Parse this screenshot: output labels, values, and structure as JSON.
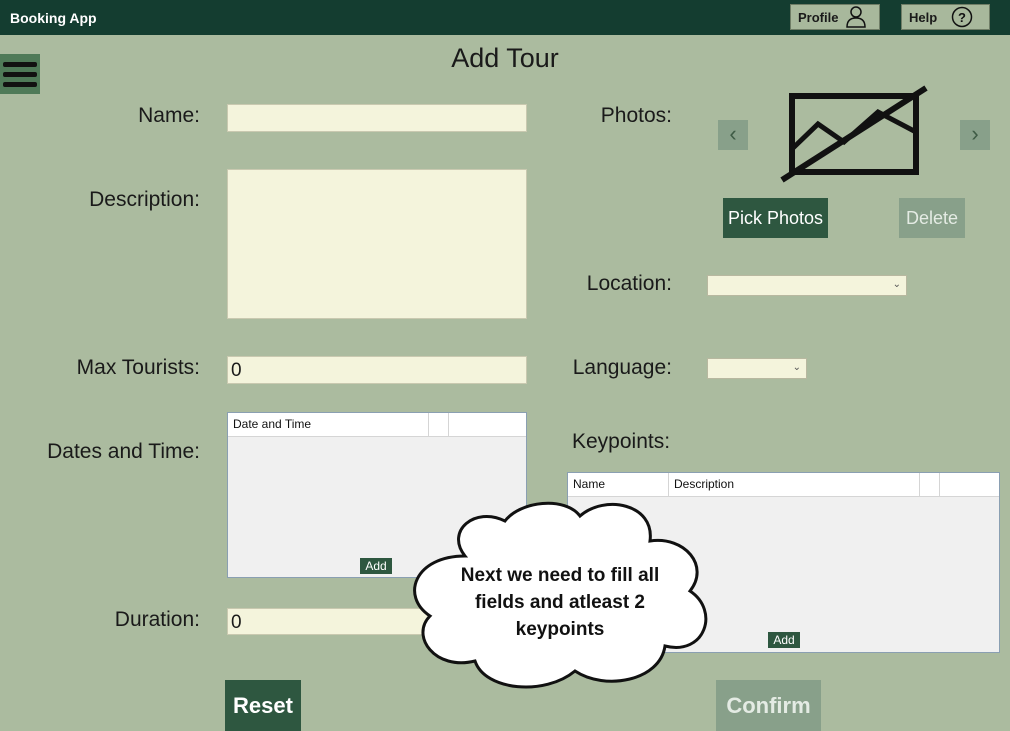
{
  "app": {
    "title": "Booking App"
  },
  "header": {
    "profile_label": "Profile",
    "help_label": "Help"
  },
  "page": {
    "title": "Add Tour"
  },
  "form": {
    "name_label": "Name:",
    "name_value": "",
    "description_label": "Description:",
    "description_value": "",
    "max_tourists_label": "Max Tourists:",
    "max_tourists_value": "0",
    "dates_label": "Dates and Time:",
    "dates_grid": {
      "columns": [
        "Date and Time",
        ""
      ],
      "add_label": "Add"
    },
    "duration_label": "Duration:",
    "duration_value": "0",
    "photos_label": "Photos:",
    "pick_photos_label": "Pick Photos",
    "delete_label": "Delete",
    "location_label": "Location:",
    "location_value": "",
    "language_label": "Language:",
    "language_value": "",
    "keypoints_label": "Keypoints:",
    "keypoints_grid": {
      "columns": [
        "Name",
        "Description",
        ""
      ],
      "add_label": "Add"
    },
    "reset_label": "Reset",
    "confirm_label": "Confirm"
  },
  "tutorial": {
    "text": "Next we need to fill all fields and atleast 2 keypoints"
  },
  "icons": {
    "profile": "person-icon",
    "help": "question-circle-icon",
    "menu": "hamburger-icon",
    "prev": "chevron-left-icon",
    "next": "chevron-right-icon",
    "no_image": "no-image-icon"
  },
  "colors": {
    "background": "#abbb9f",
    "topbar": "#143d30",
    "button_dark": "#2e5740",
    "button_disabled": "#88a08a",
    "field": "#f4f4dc"
  }
}
